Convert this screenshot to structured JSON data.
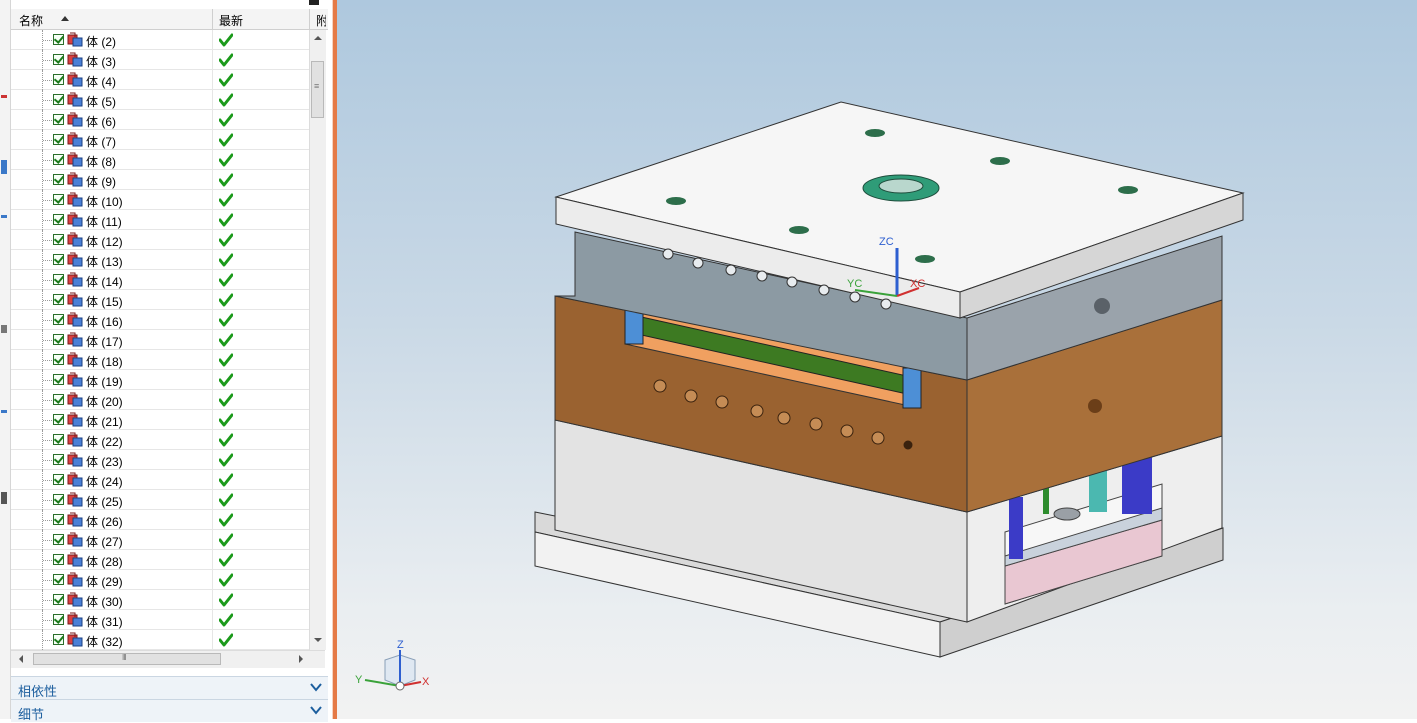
{
  "navigator": {
    "columns": {
      "name": "名称",
      "latest": "最新",
      "third": "附"
    },
    "rows": [
      {
        "label": "体 (2)"
      },
      {
        "label": "体 (3)"
      },
      {
        "label": "体 (4)"
      },
      {
        "label": "体 (5)"
      },
      {
        "label": "体 (6)"
      },
      {
        "label": "体 (7)"
      },
      {
        "label": "体 (8)"
      },
      {
        "label": "体 (9)"
      },
      {
        "label": "体 (10)"
      },
      {
        "label": "体 (11)"
      },
      {
        "label": "体 (12)"
      },
      {
        "label": "体 (13)"
      },
      {
        "label": "体 (14)"
      },
      {
        "label": "体 (15)"
      },
      {
        "label": "体 (16)"
      },
      {
        "label": "体 (17)"
      },
      {
        "label": "体 (18)"
      },
      {
        "label": "体 (19)"
      },
      {
        "label": "体 (20)"
      },
      {
        "label": "体 (21)"
      },
      {
        "label": "体 (22)"
      },
      {
        "label": "体 (23)"
      },
      {
        "label": "体 (24)"
      },
      {
        "label": "体 (25)"
      },
      {
        "label": "体 (26)"
      },
      {
        "label": "体 (27)"
      },
      {
        "label": "体 (28)"
      },
      {
        "label": "体 (29)"
      },
      {
        "label": "体 (30)"
      },
      {
        "label": "体 (31)"
      },
      {
        "label": "体 (32)"
      }
    ],
    "row_icons": {
      "check": "checkbox-checked-icon",
      "body": "solid-body-icon",
      "latest": "green-checkmark-icon"
    },
    "sections": {
      "dependencies": "相依性",
      "details": "细节"
    }
  },
  "viewport": {
    "wcs_labels": {
      "z": "ZC",
      "y": "YC",
      "x": "XC"
    },
    "triad_labels": {
      "z": "Z",
      "y": "Y",
      "x": "X"
    }
  },
  "colors": {
    "accent_divider": "#e57a46",
    "section_text": "#1c5e9e",
    "check_green": "#1b9a1b",
    "plate_white": "#f3f3f3",
    "cavity_brown": "#9a6230",
    "clamp_gray": "#9aa3ab"
  }
}
